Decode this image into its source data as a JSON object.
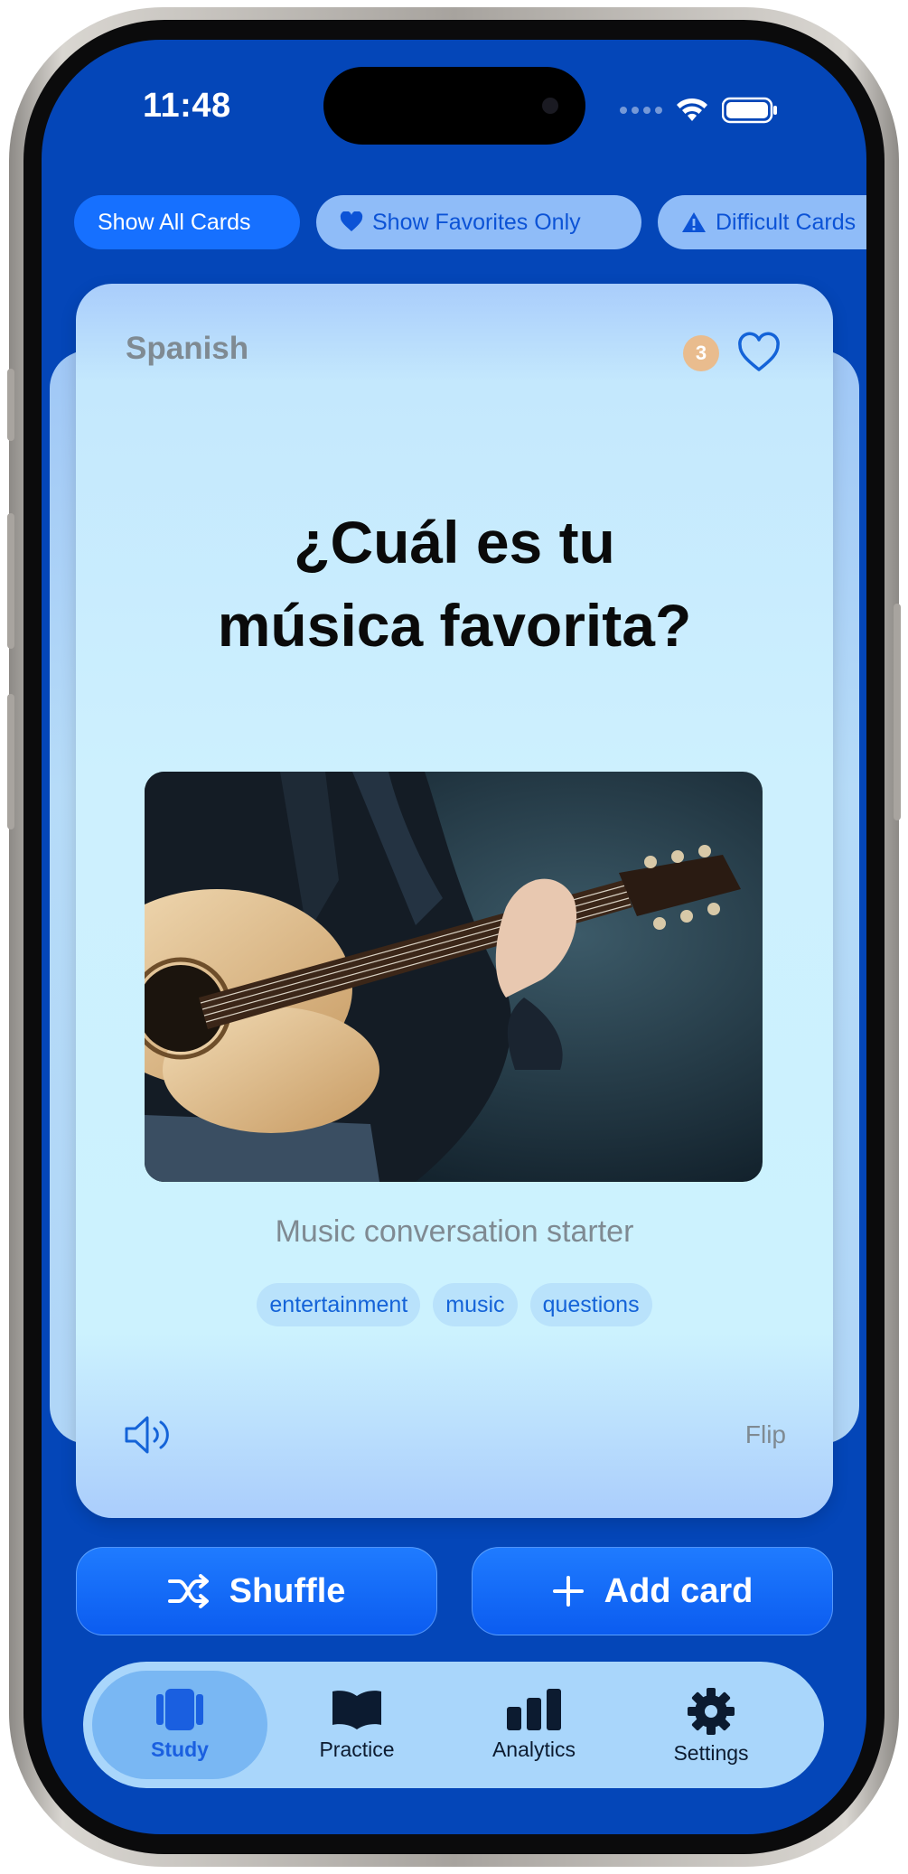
{
  "status_bar": {
    "time": "11:48"
  },
  "filters": [
    {
      "label": "Show All Cards",
      "icon": null,
      "active": true
    },
    {
      "label": "Show Favorites Only",
      "icon": "heart-icon",
      "active": false
    },
    {
      "label": "Difficult Cards",
      "icon": "warning-icon",
      "active": false
    }
  ],
  "card": {
    "language": "Spanish",
    "count": "3",
    "question_line1": "¿Cuál es tu",
    "question_line2": "música favorita?",
    "image_alt": "guitarist-photo",
    "description": "Music conversation starter",
    "tags": [
      "entertainment",
      "music",
      "questions"
    ],
    "flip_label": "Flip"
  },
  "actions": {
    "shuffle_label": "Shuffle",
    "add_label": "Add card"
  },
  "tabbar": {
    "items": [
      {
        "label": "Study",
        "icon": "cards-icon",
        "active": true
      },
      {
        "label": "Practice",
        "icon": "book-icon",
        "active": false
      },
      {
        "label": "Analytics",
        "icon": "chart-icon",
        "active": false
      },
      {
        "label": "Settings",
        "icon": "gear-icon",
        "active": false
      }
    ]
  },
  "colors": {
    "screen_bg": "#0446b8",
    "accent": "#1670ff",
    "card_bg": "#ccf2fe",
    "tag_text": "#1463d8"
  }
}
